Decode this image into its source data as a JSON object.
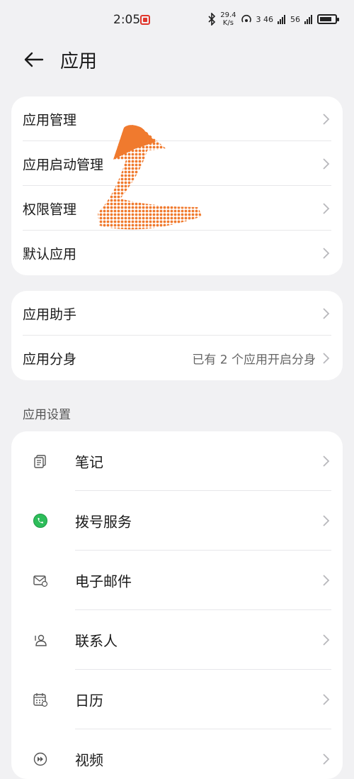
{
  "status_bar": {
    "time": "2:05",
    "speed_value": "29.4",
    "speed_unit": "K/s",
    "net1": "3 46",
    "net2": "56"
  },
  "header": {
    "title": "应用"
  },
  "group1": {
    "items": [
      {
        "label": "应用管理"
      },
      {
        "label": "应用启动管理"
      },
      {
        "label": "权限管理"
      },
      {
        "label": "默认应用"
      }
    ]
  },
  "group2": {
    "items": [
      {
        "label": "应用助手"
      },
      {
        "label": "应用分身",
        "value": "已有 2 个应用开启分身"
      }
    ]
  },
  "section": {
    "title": "应用设置"
  },
  "group3": {
    "items": [
      {
        "label": "笔记",
        "icon": "notes-icon"
      },
      {
        "label": "拨号服务",
        "icon": "phone-icon"
      },
      {
        "label": "电子邮件",
        "icon": "mail-icon"
      },
      {
        "label": "联系人",
        "icon": "contacts-icon"
      },
      {
        "label": "日历",
        "icon": "calendar-icon"
      },
      {
        "label": "视频",
        "icon": "video-icon"
      }
    ]
  },
  "colors": {
    "accent_arrow": "#f07a2e",
    "phone_green": "#2dbd5a"
  }
}
